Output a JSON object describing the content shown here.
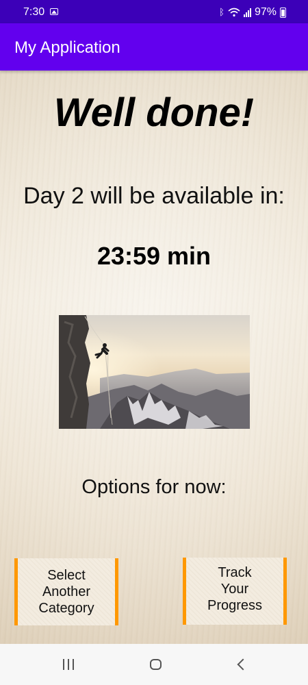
{
  "status_bar": {
    "time": "7:30",
    "battery": "97%",
    "icons": [
      "gallery-icon",
      "bluetooth-icon",
      "wifi-icon",
      "signal-icon",
      "battery-icon"
    ]
  },
  "app_bar": {
    "title": "My Application",
    "color": "#6200ee"
  },
  "main": {
    "heading": "Well done!",
    "availability_text": "Day 2 will be available in:",
    "timer": "23:59 min",
    "image_alt": "rock-climber-abseiling-mountain-photo",
    "options_label": "Options for now:",
    "buttons": {
      "select_category": [
        "Select",
        "Another",
        "Category"
      ],
      "track_progress": [
        "Track",
        "Your",
        "Progress"
      ]
    },
    "button_border_color": "#ff9800"
  },
  "nav_bar": {
    "buttons": [
      "recents-icon",
      "home-icon",
      "back-icon"
    ]
  }
}
